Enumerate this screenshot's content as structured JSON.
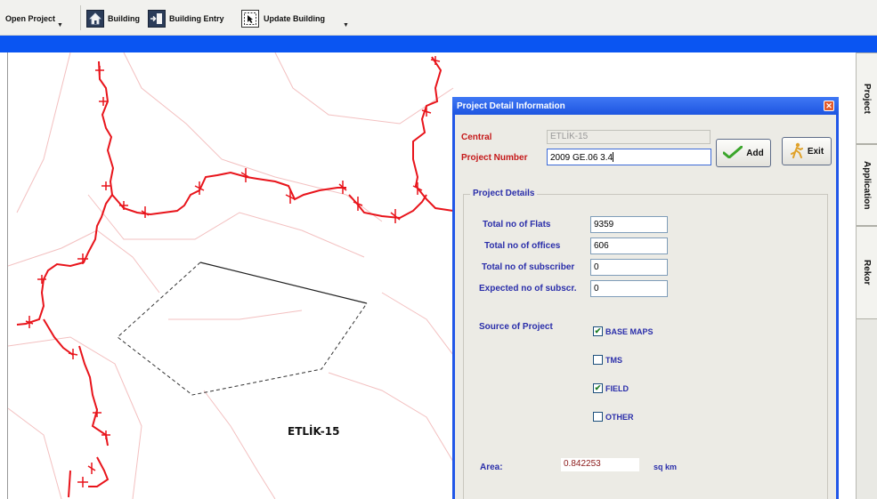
{
  "toolbar": {
    "open_project": "Open Project",
    "building": "Building",
    "building_entry": "Building Entry",
    "update_building": "Update Building",
    "dropdown_glyph": "▼"
  },
  "map": {
    "label": "ETLİK-15"
  },
  "side_tabs": {
    "project": "Project",
    "application": "Application",
    "rekor": "Rekor"
  },
  "dialog": {
    "title": "Project Detail Information",
    "close_glyph": "✕",
    "central_label": "Central",
    "central_value": "ETLİK-15",
    "project_number_label": "Project Number",
    "project_number_value": "2009 GE.06 3.4",
    "add_label": "Add",
    "exit_label": "Exit",
    "details_group": "Project Details",
    "fields": {
      "flats_label": "Total no of Flats",
      "flats_value": "9359",
      "offices_label": "Total no of offices",
      "offices_value": "606",
      "subscriber_label": "Total no of subscriber",
      "subscriber_value": "0",
      "expected_label": "Expected no of  subscr.",
      "expected_value": "0"
    },
    "source_label": "Source of Project",
    "sources": {
      "base_maps": "BASE MAPS",
      "tms": "TMS",
      "field": "FIELD",
      "other": "OTHER"
    },
    "source_checked": {
      "base_maps": true,
      "tms": false,
      "field": true,
      "other": false
    },
    "check_glyph": "✔",
    "area_label": "Area:",
    "area_value": "0.842253",
    "area_unit": "sq km"
  },
  "colors": {
    "title_blue": "#2157e8",
    "label_red": "#c5191a",
    "label_blue": "#2a2eaa",
    "map_line_red": "#e8141b",
    "map_faint_line": "#f3c0c0"
  }
}
